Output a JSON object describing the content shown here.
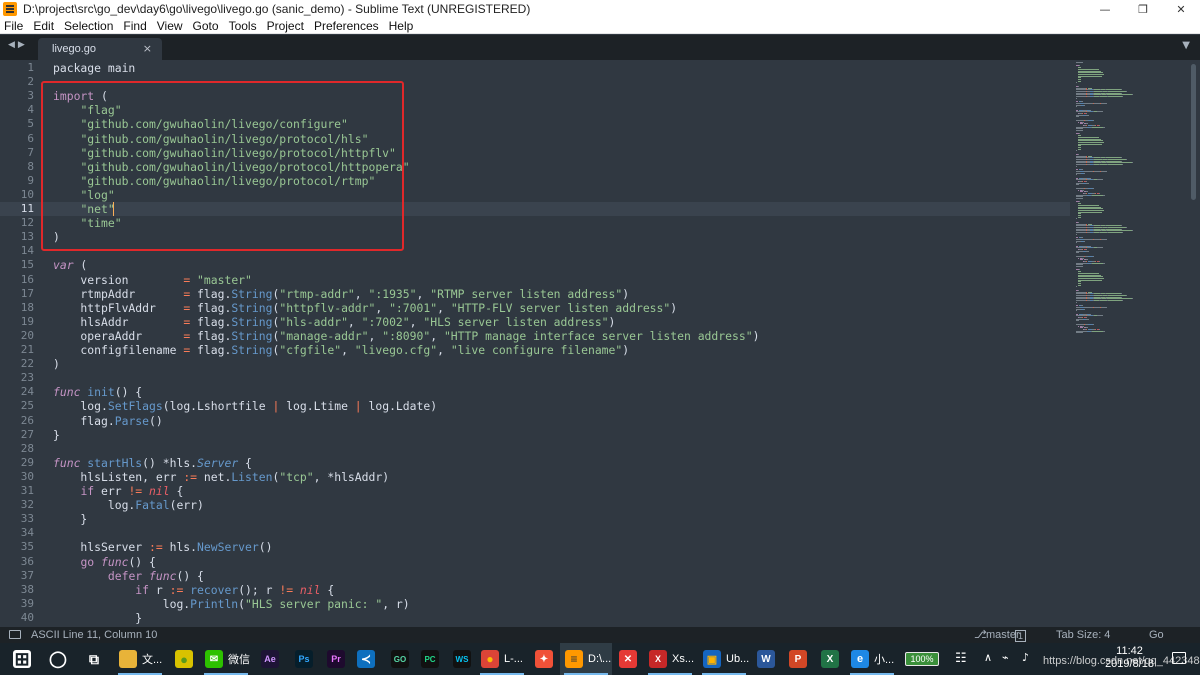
{
  "window": {
    "title": "D:\\project\\src\\go_dev\\day6\\go\\livego\\livego.go (sanic_demo) - Sublime Text (UNREGISTERED)"
  },
  "menu": [
    "File",
    "Edit",
    "Selection",
    "Find",
    "View",
    "Goto",
    "Tools",
    "Project",
    "Preferences",
    "Help"
  ],
  "tab": {
    "label": "livego.go",
    "close_glyph": "×"
  },
  "editor": {
    "active_line": 11,
    "lines": [
      [
        [
          "package main",
          "plain"
        ]
      ],
      [],
      [
        [
          "import",
          "kw2"
        ],
        [
          " (",
          "punct"
        ]
      ],
      [
        [
          "    ",
          "plain"
        ],
        [
          "\"flag\"",
          "str"
        ]
      ],
      [
        [
          "    ",
          "plain"
        ],
        [
          "\"github.com/gwuhaolin/livego/configure\"",
          "str"
        ]
      ],
      [
        [
          "    ",
          "plain"
        ],
        [
          "\"github.com/gwuhaolin/livego/protocol/hls\"",
          "str"
        ]
      ],
      [
        [
          "    ",
          "plain"
        ],
        [
          "\"github.com/gwuhaolin/livego/protocol/httpflv\"",
          "str"
        ]
      ],
      [
        [
          "    ",
          "plain"
        ],
        [
          "\"github.com/gwuhaolin/livego/protocol/httpopera\"",
          "str"
        ]
      ],
      [
        [
          "    ",
          "plain"
        ],
        [
          "\"github.com/gwuhaolin/livego/protocol/rtmp\"",
          "str"
        ]
      ],
      [
        [
          "    ",
          "plain"
        ],
        [
          "\"log\"",
          "str"
        ]
      ],
      [
        [
          "    ",
          "plain"
        ],
        [
          "\"net\"",
          "str"
        ]
      ],
      [
        [
          "    ",
          "plain"
        ],
        [
          "\"time\"",
          "str"
        ]
      ],
      [
        [
          ")",
          "punct"
        ]
      ],
      [],
      [
        [
          "var",
          "kw"
        ],
        [
          " (",
          "punct"
        ]
      ],
      [
        [
          "    version        ",
          "plain"
        ],
        [
          "=",
          "op"
        ],
        [
          " ",
          "plain"
        ],
        [
          "\"master\"",
          "str"
        ]
      ],
      [
        [
          "    rtmpAddr       ",
          "plain"
        ],
        [
          "=",
          "op"
        ],
        [
          " flag.",
          "plain"
        ],
        [
          "String",
          "fn"
        ],
        [
          "(",
          "punct"
        ],
        [
          "\"rtmp-addr\"",
          "str"
        ],
        [
          ", ",
          "punct"
        ],
        [
          "\":1935\"",
          "str"
        ],
        [
          ", ",
          "punct"
        ],
        [
          "\"RTMP server listen address\"",
          "str"
        ],
        [
          ")",
          "punct"
        ]
      ],
      [
        [
          "    httpFlvAddr    ",
          "plain"
        ],
        [
          "=",
          "op"
        ],
        [
          " flag.",
          "plain"
        ],
        [
          "String",
          "fn"
        ],
        [
          "(",
          "punct"
        ],
        [
          "\"httpflv-addr\"",
          "str"
        ],
        [
          ", ",
          "punct"
        ],
        [
          "\":7001\"",
          "str"
        ],
        [
          ", ",
          "punct"
        ],
        [
          "\"HTTP-FLV server listen address\"",
          "str"
        ],
        [
          ")",
          "punct"
        ]
      ],
      [
        [
          "    hlsAddr        ",
          "plain"
        ],
        [
          "=",
          "op"
        ],
        [
          " flag.",
          "plain"
        ],
        [
          "String",
          "fn"
        ],
        [
          "(",
          "punct"
        ],
        [
          "\"hls-addr\"",
          "str"
        ],
        [
          ", ",
          "punct"
        ],
        [
          "\":7002\"",
          "str"
        ],
        [
          ", ",
          "punct"
        ],
        [
          "\"HLS server listen address\"",
          "str"
        ],
        [
          ")",
          "punct"
        ]
      ],
      [
        [
          "    operaAddr      ",
          "plain"
        ],
        [
          "=",
          "op"
        ],
        [
          " flag.",
          "plain"
        ],
        [
          "String",
          "fn"
        ],
        [
          "(",
          "punct"
        ],
        [
          "\"manage-addr\"",
          "str"
        ],
        [
          ", ",
          "punct"
        ],
        [
          "\":8090\"",
          "str"
        ],
        [
          ", ",
          "punct"
        ],
        [
          "\"HTTP manage interface server listen address\"",
          "str"
        ],
        [
          ")",
          "punct"
        ]
      ],
      [
        [
          "    configfilename ",
          "plain"
        ],
        [
          "=",
          "op"
        ],
        [
          " flag.",
          "plain"
        ],
        [
          "String",
          "fn"
        ],
        [
          "(",
          "punct"
        ],
        [
          "\"cfgfile\"",
          "str"
        ],
        [
          ", ",
          "punct"
        ],
        [
          "\"livego.cfg\"",
          "str"
        ],
        [
          ", ",
          "punct"
        ],
        [
          "\"live configure filename\"",
          "str"
        ],
        [
          ")",
          "punct"
        ]
      ],
      [
        [
          ")",
          "punct"
        ]
      ],
      [],
      [
        [
          "func",
          "kw"
        ],
        [
          " ",
          "plain"
        ],
        [
          "init",
          "fn"
        ],
        [
          "() {",
          "punct"
        ]
      ],
      [
        [
          "    log.",
          "plain"
        ],
        [
          "SetFlags",
          "fn"
        ],
        [
          "(log.Lshortfile ",
          "plain"
        ],
        [
          "|",
          "op"
        ],
        [
          " log.Ltime ",
          "plain"
        ],
        [
          "|",
          "op"
        ],
        [
          " log.Ldate)",
          "plain"
        ]
      ],
      [
        [
          "    flag.",
          "plain"
        ],
        [
          "Parse",
          "fn"
        ],
        [
          "()",
          "punct"
        ]
      ],
      [
        [
          "}",
          "punct"
        ]
      ],
      [],
      [
        [
          "func",
          "kw"
        ],
        [
          " ",
          "plain"
        ],
        [
          "startHls",
          "fn"
        ],
        [
          "() *hls.",
          "plain"
        ],
        [
          "Server",
          "type"
        ],
        [
          " {",
          "punct"
        ]
      ],
      [
        [
          "    hlsListen, err ",
          "plain"
        ],
        [
          ":=",
          "op"
        ],
        [
          " net.",
          "plain"
        ],
        [
          "Listen",
          "fn"
        ],
        [
          "(",
          "punct"
        ],
        [
          "\"tcp\"",
          "str"
        ],
        [
          ", *hlsAddr)",
          "plain"
        ]
      ],
      [
        [
          "    ",
          "plain"
        ],
        [
          "if",
          "kw2"
        ],
        [
          " err ",
          "plain"
        ],
        [
          "!=",
          "op"
        ],
        [
          " ",
          "plain"
        ],
        [
          "nil",
          "nil"
        ],
        [
          " {",
          "punct"
        ]
      ],
      [
        [
          "        log.",
          "plain"
        ],
        [
          "Fatal",
          "fn"
        ],
        [
          "(err)",
          "plain"
        ]
      ],
      [
        [
          "    }",
          "punct"
        ]
      ],
      [],
      [
        [
          "    hlsServer ",
          "plain"
        ],
        [
          ":=",
          "op"
        ],
        [
          " hls.",
          "plain"
        ],
        [
          "NewServer",
          "fn"
        ],
        [
          "()",
          "punct"
        ]
      ],
      [
        [
          "    ",
          "plain"
        ],
        [
          "go",
          "kw2"
        ],
        [
          " ",
          "plain"
        ],
        [
          "func",
          "kw"
        ],
        [
          "() {",
          "punct"
        ]
      ],
      [
        [
          "        ",
          "plain"
        ],
        [
          "defer",
          "kw2"
        ],
        [
          " ",
          "plain"
        ],
        [
          "func",
          "kw"
        ],
        [
          "() {",
          "punct"
        ]
      ],
      [
        [
          "            ",
          "plain"
        ],
        [
          "if",
          "kw2"
        ],
        [
          " r ",
          "plain"
        ],
        [
          ":=",
          "op"
        ],
        [
          " ",
          "plain"
        ],
        [
          "recover",
          "fn"
        ],
        [
          "(); r ",
          "plain"
        ],
        [
          "!=",
          "op"
        ],
        [
          " ",
          "plain"
        ],
        [
          "nil",
          "nil"
        ],
        [
          " {",
          "punct"
        ]
      ],
      [
        [
          "                log.",
          "plain"
        ],
        [
          "Println",
          "fn"
        ],
        [
          "(",
          "punct"
        ],
        [
          "\"HLS server panic: \"",
          "str"
        ],
        [
          ", r)",
          "plain"
        ]
      ],
      [
        [
          "            }",
          "punct"
        ]
      ]
    ]
  },
  "statusbar": {
    "position": "ASCII Line 11, Column 10",
    "branch": "master",
    "branch_count": "1",
    "tab_size": "Tab Size: 4",
    "syntax": "Go"
  },
  "taskbar": {
    "items": [
      {
        "name": "windows-start",
        "icon": "windows-icon",
        "label": ""
      },
      {
        "name": "cortana",
        "icon": "search-ring-icon",
        "label": ""
      },
      {
        "name": "task-view",
        "icon": "task-view-icon",
        "label": ""
      },
      {
        "name": "file-explorer",
        "icon": "folder-icon",
        "label": "文..."
      },
      {
        "name": "app-yellow",
        "icon": "yellow-app-icon",
        "label": ""
      },
      {
        "name": "wechat",
        "icon": "wechat-icon",
        "label": "微信"
      },
      {
        "name": "after-effects",
        "icon": "ae-icon",
        "label": ""
      },
      {
        "name": "photoshop",
        "icon": "ps-icon",
        "label": ""
      },
      {
        "name": "premiere",
        "icon": "pr-icon",
        "label": ""
      },
      {
        "name": "vscode",
        "icon": "vscode-icon",
        "label": ""
      },
      {
        "name": "goland",
        "icon": "goland-icon",
        "label": ""
      },
      {
        "name": "pycharm",
        "icon": "pycharm-icon",
        "label": ""
      },
      {
        "name": "webstorm",
        "icon": "webstorm-icon",
        "label": ""
      },
      {
        "name": "chrome",
        "icon": "chrome-icon",
        "label": "L-..."
      },
      {
        "name": "swift-app",
        "icon": "orange-compass-icon",
        "label": ""
      },
      {
        "name": "sublime",
        "icon": "sublime-icon",
        "label": "D:\\..."
      },
      {
        "name": "xmind",
        "icon": "xmind-icon",
        "label": ""
      },
      {
        "name": "xshell",
        "icon": "xshell-icon",
        "label": "Xs..."
      },
      {
        "name": "ubuntu-vm",
        "icon": "vm-icon",
        "label": "Ub..."
      },
      {
        "name": "word",
        "icon": "word-icon",
        "label": ""
      },
      {
        "name": "powerpoint",
        "icon": "ppt-icon",
        "label": ""
      },
      {
        "name": "excel",
        "icon": "excel-icon",
        "label": ""
      },
      {
        "name": "browser-small",
        "icon": "browser-icon",
        "label": "小..."
      },
      {
        "name": "notes",
        "icon": "notes-icon",
        "label": ""
      }
    ],
    "battery": "100%",
    "time": "11:42",
    "date": "2019/8/18",
    "watermark": "https://blog.csdn.net/qq_44234844"
  },
  "colors": {
    "annotation_box": "#e0282a",
    "editor_bg": "#303841",
    "string": "#99c794",
    "keyword": "#c594c5",
    "function": "#6699cc",
    "operator": "#f97b58"
  }
}
